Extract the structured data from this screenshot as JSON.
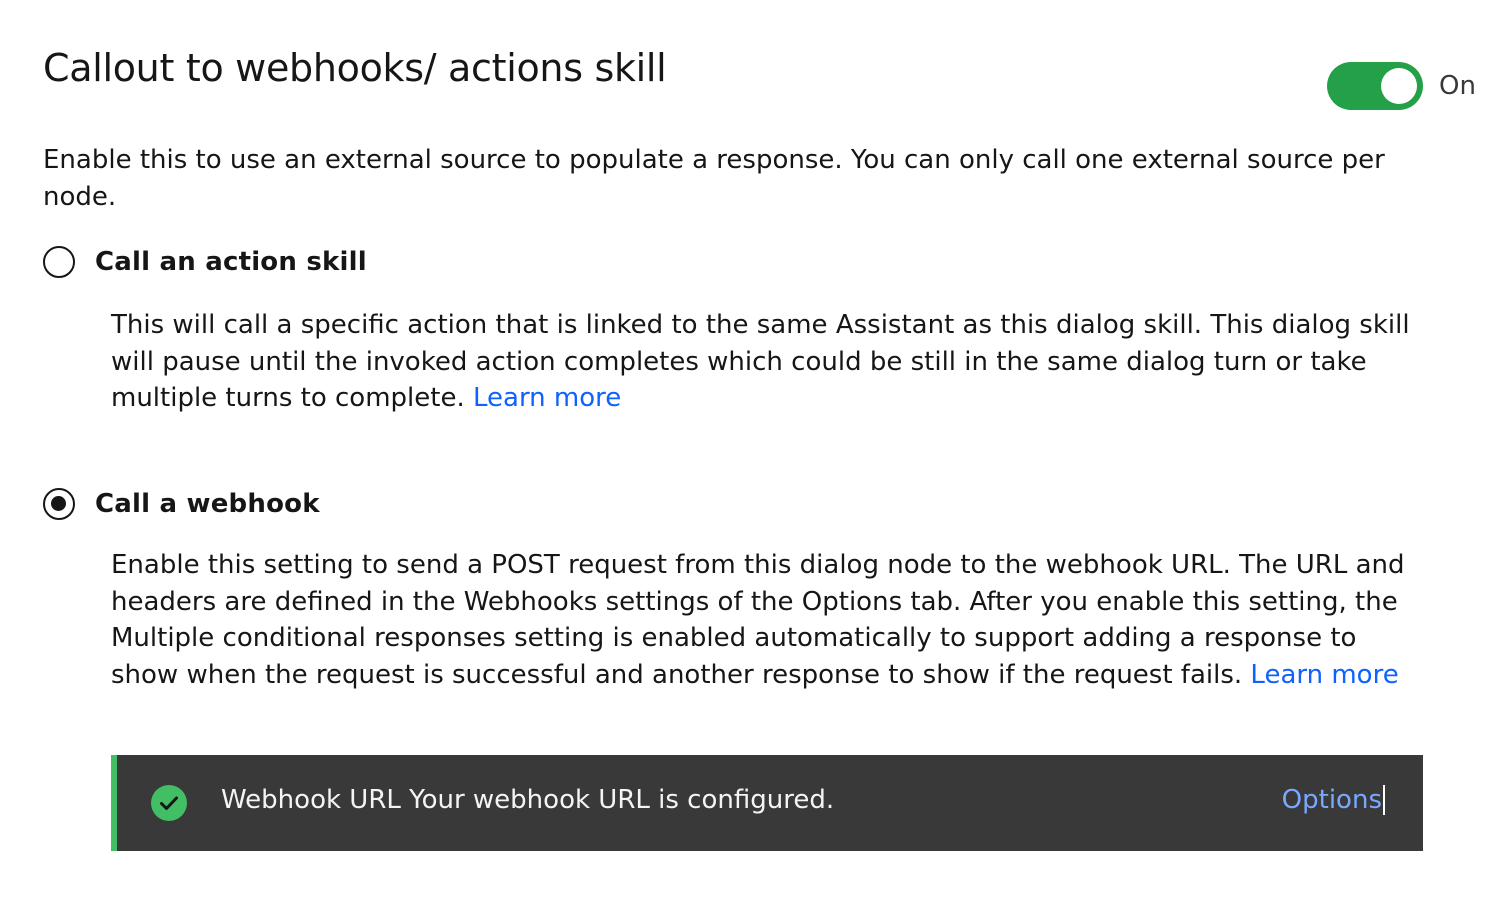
{
  "section": {
    "title": "Callout to webhooks/ actions skill",
    "toggle": {
      "state": "on",
      "label": "On",
      "color": "#24a148"
    },
    "description": "Enable this to use an external source to populate a response. You can only call one external source per node."
  },
  "options": [
    {
      "label": "Call an action skill",
      "selected": false,
      "description": "This will call a specific action that is linked to the same Assistant as this dialog skill. This dialog skill will pause until the invoked action completes which could be still in the same dialog turn or take multiple turns to complete.",
      "link": "Learn more"
    },
    {
      "label": "Call a webhook",
      "selected": true,
      "description": "Enable this setting to send a POST request from this dialog node to the webhook URL. The URL and headers are defined in the Webhooks settings of the Options tab. After you enable this setting, the Multiple conditional responses setting is enabled automatically to support adding a response to show when the request is successful and another response to show if the request fails.",
      "link": "Learn more"
    }
  ],
  "notification": {
    "icon": "checkmark-filled-icon",
    "kind": "success",
    "message": "Webhook URL Your webhook URL is configured.",
    "action": "Options",
    "accent_color": "#42be65"
  }
}
